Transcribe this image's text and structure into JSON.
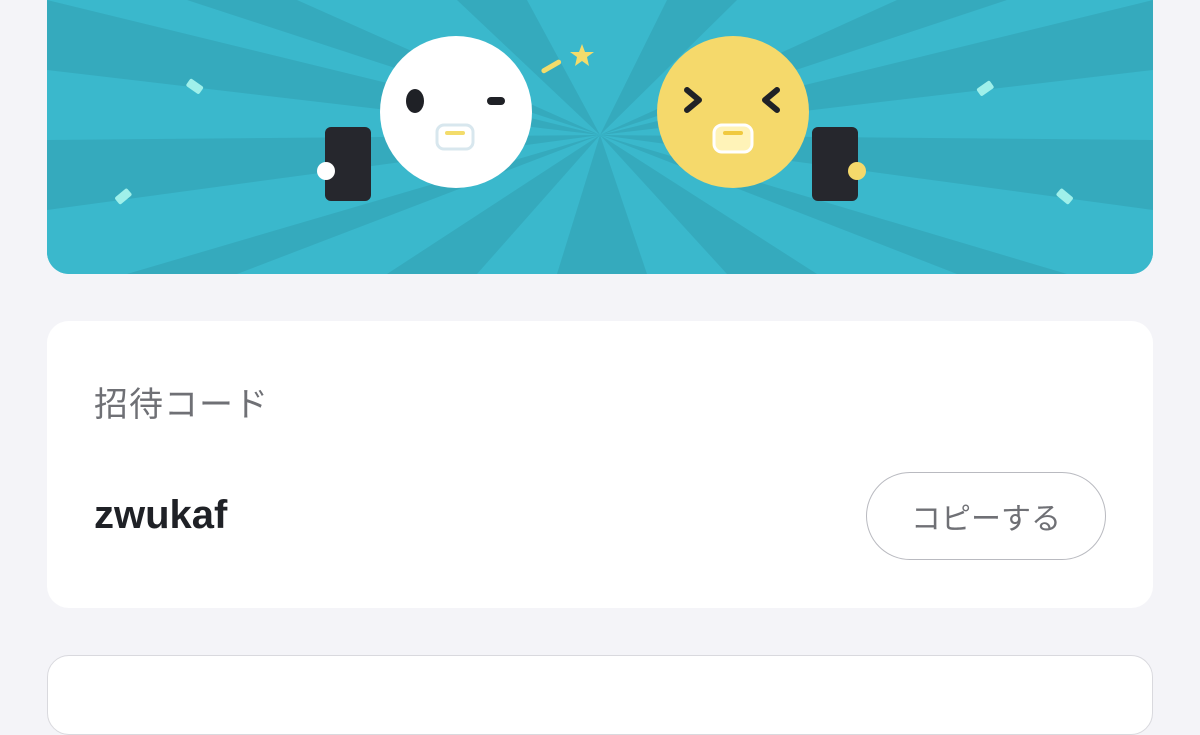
{
  "banner": {
    "background_color": "#3ab8cc",
    "ray_color": "#35aabd",
    "left_face_color": "#ffffff",
    "right_face_color": "#f5d96b",
    "phone_color": "#26272d",
    "confetti_color": "#9ff0ea",
    "star_color": "#f3dc6b"
  },
  "invite": {
    "title": "招待コード",
    "code": "zwukaf",
    "copy_label": "コピーする"
  },
  "colors": {
    "page_background": "#f4f4f8",
    "card_background": "#ffffff",
    "text_primary": "#1f2126",
    "text_secondary": "#6f7075",
    "button_border": "#b9bac0"
  }
}
